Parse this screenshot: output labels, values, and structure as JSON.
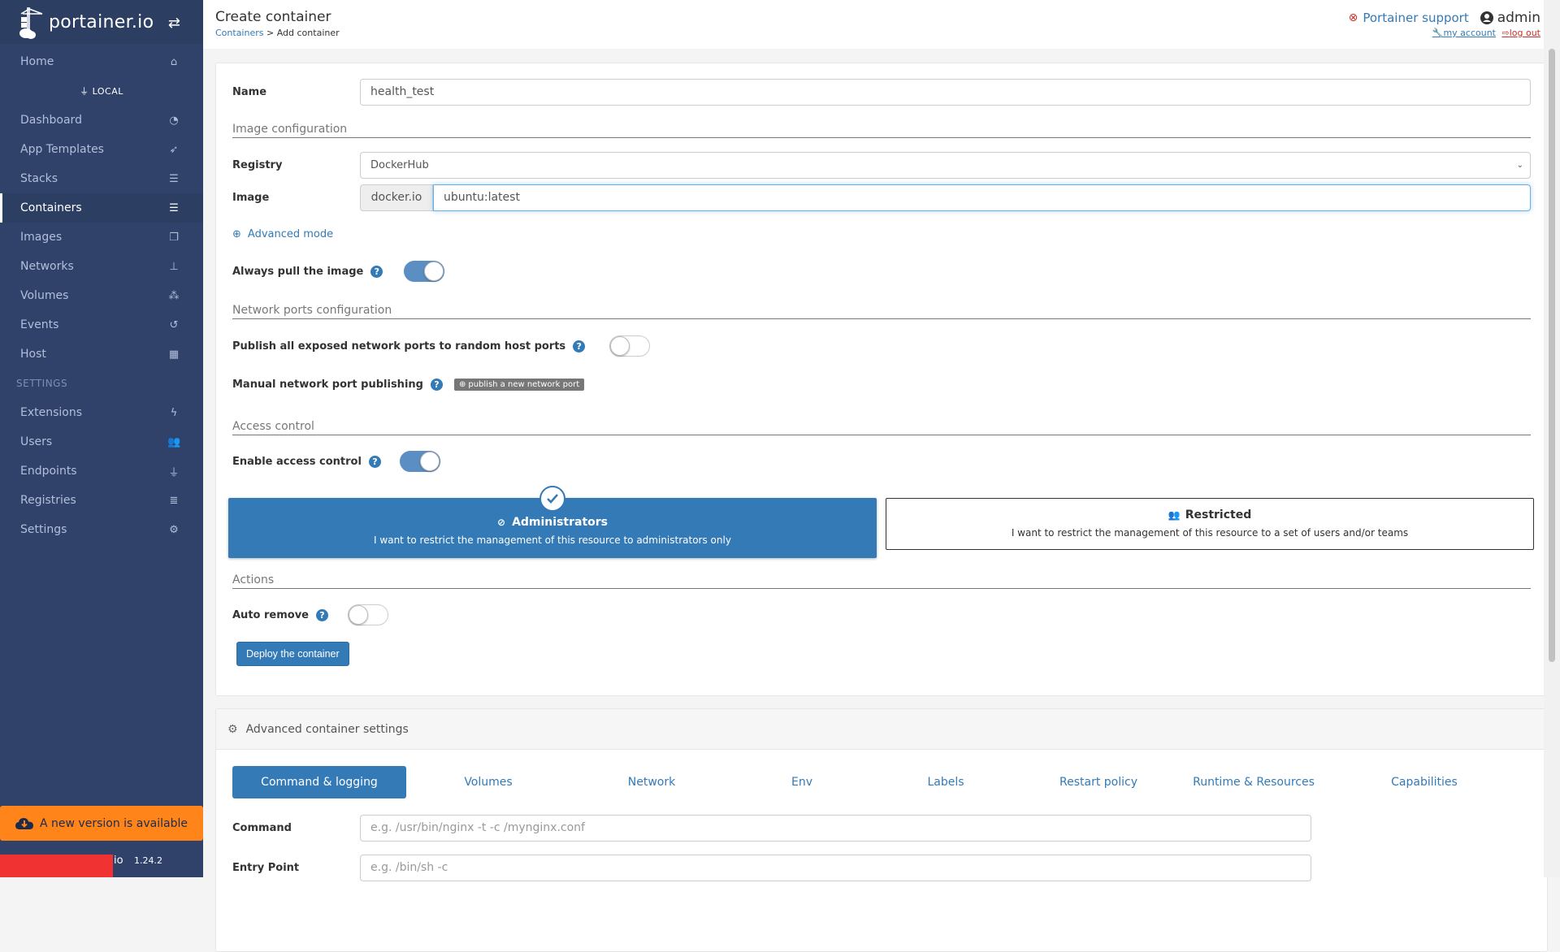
{
  "brand": {
    "name": "portainer.io"
  },
  "sidebar": {
    "home": "Home",
    "endpoint": "LOCAL",
    "items": [
      {
        "label": "Dashboard",
        "icon": "tachometer-icon"
      },
      {
        "label": "App Templates",
        "icon": "rocket-icon"
      },
      {
        "label": "Stacks",
        "icon": "th-list-icon"
      },
      {
        "label": "Containers",
        "icon": "server-icon",
        "active": true
      },
      {
        "label": "Images",
        "icon": "clone-icon"
      },
      {
        "label": "Networks",
        "icon": "sitemap-icon"
      },
      {
        "label": "Volumes",
        "icon": "cubes-icon"
      },
      {
        "label": "Events",
        "icon": "history-icon"
      },
      {
        "label": "Host",
        "icon": "th-icon"
      }
    ],
    "settings_header": "SETTINGS",
    "settings_items": [
      {
        "label": "Extensions",
        "icon": "bolt-icon"
      },
      {
        "label": "Users",
        "icon": "users-icon"
      },
      {
        "label": "Endpoints",
        "icon": "plug-icon"
      },
      {
        "label": "Registries",
        "icon": "database-icon"
      },
      {
        "label": "Settings",
        "icon": "cogs-icon"
      }
    ],
    "update_banner": "A new version is available",
    "footer_io": "io",
    "version": "1.24.2"
  },
  "header": {
    "title": "Create container",
    "breadcrumb_link": "Containers",
    "breadcrumb_sep": " > ",
    "breadcrumb_current": "Add container",
    "support": "Portainer support",
    "user": "admin",
    "my_account": "my account",
    "log_out": "log out"
  },
  "form": {
    "name_label": "Name",
    "name_value": "health_test",
    "image_config_title": "Image configuration",
    "registry_label": "Registry",
    "registry_value": "DockerHub",
    "image_label": "Image",
    "image_prefix": "docker.io",
    "image_value": "ubuntu:latest",
    "advanced_mode": "Advanced mode",
    "always_pull_label": "Always pull the image",
    "always_pull": true,
    "network_ports_title": "Network ports configuration",
    "publish_all_label": "Publish all exposed network ports to random host ports",
    "publish_all": false,
    "manual_port_label": "Manual network port publishing",
    "publish_new_port": "publish a new network port",
    "access_control_title": "Access control",
    "enable_access_label": "Enable access control",
    "enable_access": true,
    "admin_title": "Administrators",
    "admin_desc": "I want to restrict the management of this resource to administrators only",
    "restricted_title": "Restricted",
    "restricted_desc": "I want to restrict the management of this resource to a set of users and/or teams",
    "actions_title": "Actions",
    "auto_remove_label": "Auto remove",
    "auto_remove": false,
    "deploy_button": "Deploy the container"
  },
  "advanced": {
    "title": "Advanced container settings",
    "tabs": [
      "Command & logging",
      "Volumes",
      "Network",
      "Env",
      "Labels",
      "Restart policy",
      "Runtime & Resources",
      "Capabilities"
    ],
    "active_tab": "Command & logging",
    "command_label": "Command",
    "command_placeholder": "e.g. /usr/bin/nginx -t -c /mynginx.conf",
    "entrypoint_label": "Entry Point",
    "entrypoint_placeholder": "e.g. /bin/sh -c"
  },
  "colors": {
    "sidebar_bg": "#30426a",
    "primary": "#337ab7",
    "update_banner": "#ff851b",
    "danger": "#c9302c"
  }
}
